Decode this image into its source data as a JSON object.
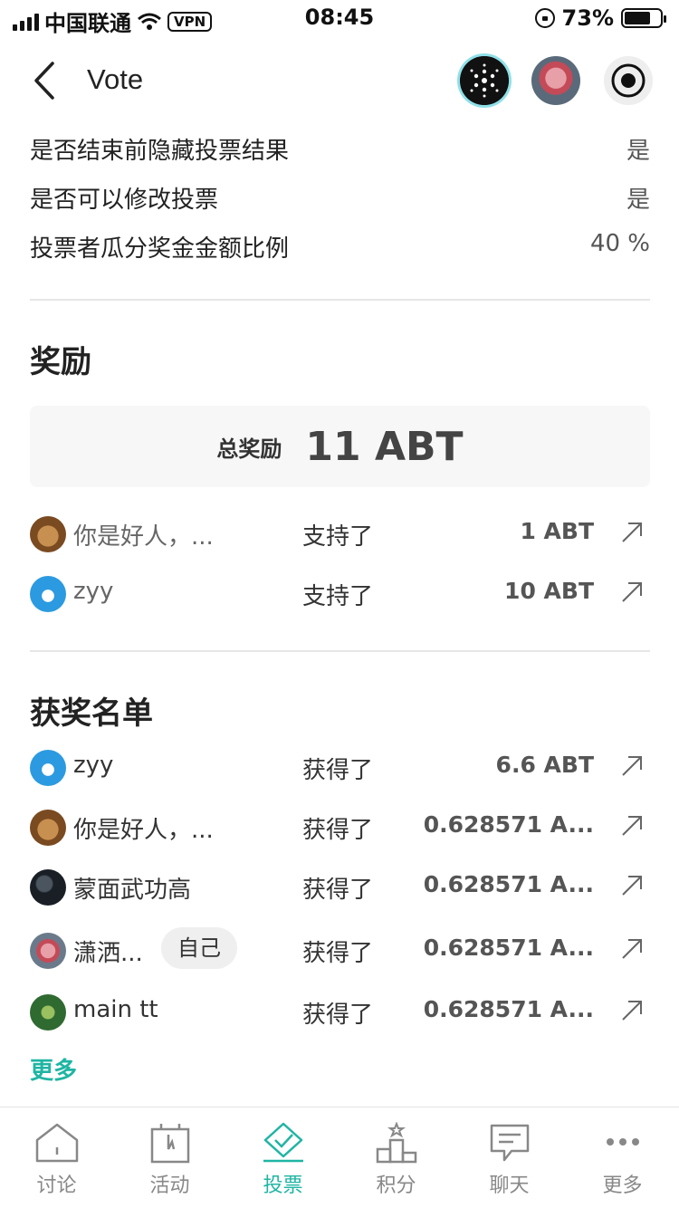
{
  "status_bar": {
    "carrier": "中国联通",
    "vpn": "VPN",
    "time": "08:45",
    "battery": "73%",
    "battery_level": 0.73
  },
  "header": {
    "title": "Vote"
  },
  "settings": [
    {
      "label": "是否结束前隐藏投票结果",
      "value": "是"
    },
    {
      "label": "是否可以修改投票",
      "value": "是"
    },
    {
      "label": "投票者瓜分奖金金额比例",
      "value": "40 %"
    }
  ],
  "rewards": {
    "title": "奖励",
    "total_label": "总奖励",
    "total_value": "11 ABT",
    "supporters": [
      {
        "name": "你是好人，...",
        "action": "支持了",
        "amount": "1 ABT",
        "avatar": "bear-avatar"
      },
      {
        "name": "zyy",
        "action": "支持了",
        "amount": "10 ABT",
        "avatar": "doraemon-avatar"
      }
    ]
  },
  "winners": {
    "title": "获奖名单",
    "self_badge": "自己",
    "list": [
      {
        "name": "zyy",
        "action": "获得了",
        "amount": "6.6 ABT",
        "avatar": "doraemon-avatar"
      },
      {
        "name": "你是好人，...",
        "action": "获得了",
        "amount": "0.628571 A...",
        "avatar": "bear-avatar"
      },
      {
        "name": "蒙面武功高",
        "action": "获得了",
        "amount": "0.628571 A...",
        "avatar": "dark-avatar"
      },
      {
        "name": "潇洒...",
        "action": "获得了",
        "amount": "0.628571 A...",
        "avatar": "self-avatar"
      },
      {
        "name": "main tt",
        "action": "获得了",
        "amount": "0.628571 A...",
        "avatar": "tree-avatar"
      }
    ],
    "more_label": "更多"
  },
  "tabbar": {
    "tabs": [
      {
        "label": "讨论",
        "icon": "home-icon"
      },
      {
        "label": "活动",
        "icon": "gift-icon"
      },
      {
        "label": "投票",
        "icon": "ballot-box-icon"
      },
      {
        "label": "积分",
        "icon": "podium-icon"
      },
      {
        "label": "聊天",
        "icon": "chat-icon"
      },
      {
        "label": "更多",
        "icon": "more-dots-icon"
      }
    ],
    "active": "投票"
  },
  "colors": {
    "accent": "#1fb5a3",
    "text": "#222222",
    "muted": "#888888"
  }
}
